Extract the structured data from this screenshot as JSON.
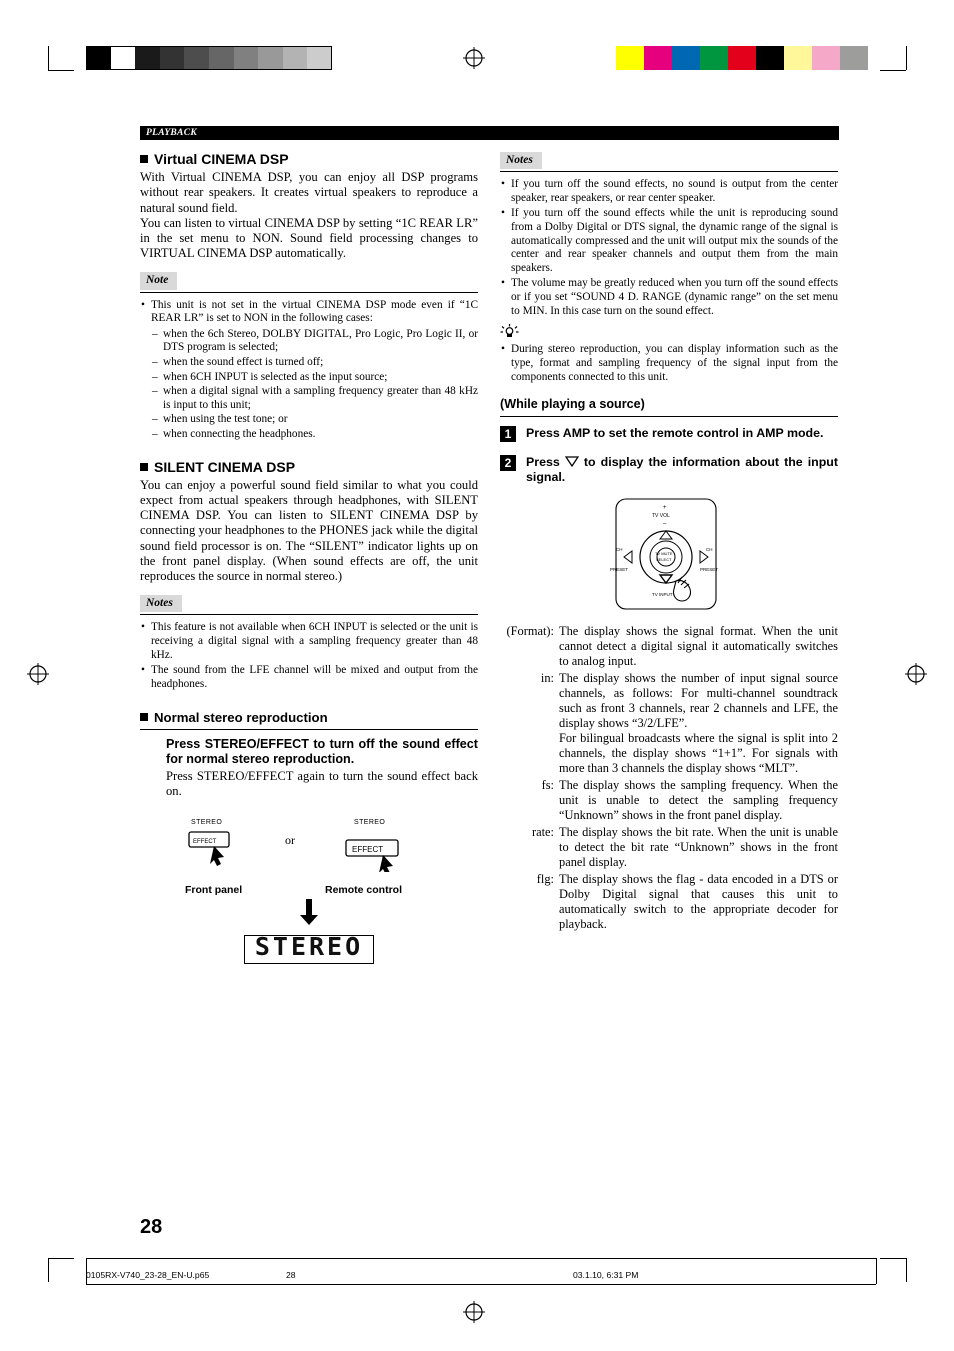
{
  "header": {
    "section": "PLAYBACK"
  },
  "page_number": "28",
  "left": {
    "s1_title": "Virtual CINEMA DSP",
    "s1_p1": "With Virtual CINEMA DSP, you can enjoy all DSP programs without rear speakers. It creates virtual speakers to reproduce a natural sound field.",
    "s1_p2": "You can listen to virtual CINEMA DSP by setting “1C REAR LR” in the set menu to NON. Sound field processing changes to VIRTUAL CINEMA DSP automatically.",
    "note_tag": "Note",
    "note_bullet": "This unit is not set in the virtual CINEMA DSP mode even if “1C REAR LR” is set to NON in the following cases:",
    "note_dashes": [
      "when the 6ch Stereo, DOLBY DIGITAL, Pro Logic, Pro Logic II, or DTS program is selected;",
      "when the sound effect is turned off;",
      "when 6CH INPUT is selected as the input source;",
      "when a digital signal with a sampling frequency greater than 48 kHz is input to this unit;",
      "when using the test tone; or",
      "when connecting the headphones."
    ],
    "s2_title": "SILENT CINEMA DSP",
    "s2_p1": "You can enjoy a powerful sound field similar to what you could expect from actual speakers through headphones, with SILENT CINEMA DSP. You can listen to SILENT CINEMA DSP by connecting your headphones to the PHONES jack while the digital sound field processor is on. The “SILENT” indicator lights up on the front panel display. (When sound effects are off, the unit reproduces the source in normal stereo.)",
    "notes_tag": "Notes",
    "notes_bullets": [
      "This feature is not available when 6CH INPUT is selected or the unit is receiving a digital signal with a sampling frequency greater than 48 kHz.",
      "The sound from the LFE channel will be mixed and output from the headphones."
    ],
    "s3_title": "Normal stereo reproduction",
    "s3_bold": "Press STEREO/EFFECT to turn off the sound effect for normal stereo reproduction.",
    "s3_p": "Press STEREO/EFFECT again to turn the sound effect back on.",
    "fig_front_stereo": "STEREO",
    "fig_front_effect": "EFFECT",
    "fig_or": "or",
    "fig_remote_stereo": "STEREO",
    "fig_remote_effect": "EFFECT",
    "fig_front_caption": "Front panel",
    "fig_remote_caption": "Remote control",
    "lcd_text": "STEREO"
  },
  "right": {
    "notes_tag": "Notes",
    "notes_bullets": [
      "If you turn off the sound effects, no sound is output from the center speaker, rear speakers, or rear center speaker.",
      "If you turn off the sound effects while the unit is reproducing sound from a Dolby Digital or DTS signal, the dynamic range of the signal is automatically compressed and the unit will output mix the sounds of the center and rear speaker channels and output them from the main speakers.",
      "The volume may be greatly reduced when you turn off the sound effects or if you set “SOUND 4 D. RANGE (dynamic range” on the set menu to MIN. In this case turn on the sound effect."
    ],
    "tip_bullet": "During stereo reproduction, you can display information such as the type, format and sampling frequency of the signal input from the components connected to this unit.",
    "while_playing": "(While playing a source)",
    "step1_num": "1",
    "step1_text": "Press AMP to set the remote control in AMP mode.",
    "step2_num": "2",
    "step2_text_a": "Press",
    "step2_text_b": "to display the information about the input signal.",
    "remote_labels": {
      "tv_vol_up": "+",
      "tv_vol": "TV VOL",
      "tv_vol_down": "–",
      "ch_left": "CH",
      "preset_left": "PRESET",
      "ch_right": "CH",
      "preset_right": "PRESET",
      "mute": "TV MUTE",
      "select": "SELECT",
      "tv_input": "TV INPUT"
    },
    "deflist": [
      {
        "term": "(Format):",
        "def": "The display shows the signal format. When the unit cannot detect a digital signal it automatically switches to analog input."
      },
      {
        "term": "in:",
        "def": "The display shows the number of input signal source channels, as follows: For multi-channel soundtrack such as front 3 channels, rear 2 channels and LFE, the display shows “3/2/LFE”.\nFor bilingual broadcasts where the signal is split into 2 channels, the display shows “1+1”. For signals with more than 3 channels the display shows “MLT”."
      },
      {
        "term": "fs:",
        "def": "The display shows the sampling frequency. When the unit is unable to detect the sampling frequency “Unknown” shows in the front panel display."
      },
      {
        "term": "rate:",
        "def": "The display shows the bit rate. When the unit is unable to detect the bit rate “Unknown” shows in the front panel display."
      },
      {
        "term": "flg:",
        "def": "The display shows the flag - data encoded in a DTS or Dolby Digital signal that causes this unit to automatically switch to the appropriate decoder for playback."
      }
    ]
  },
  "footer": {
    "filename": "0105RX-V740_23-28_EN-U.p65",
    "page": "28",
    "date": "03.1.10, 6:31 PM"
  },
  "colors": {
    "bar_bg": "#000000",
    "tag_bg": "#d9d9d9",
    "text": "#000000"
  }
}
